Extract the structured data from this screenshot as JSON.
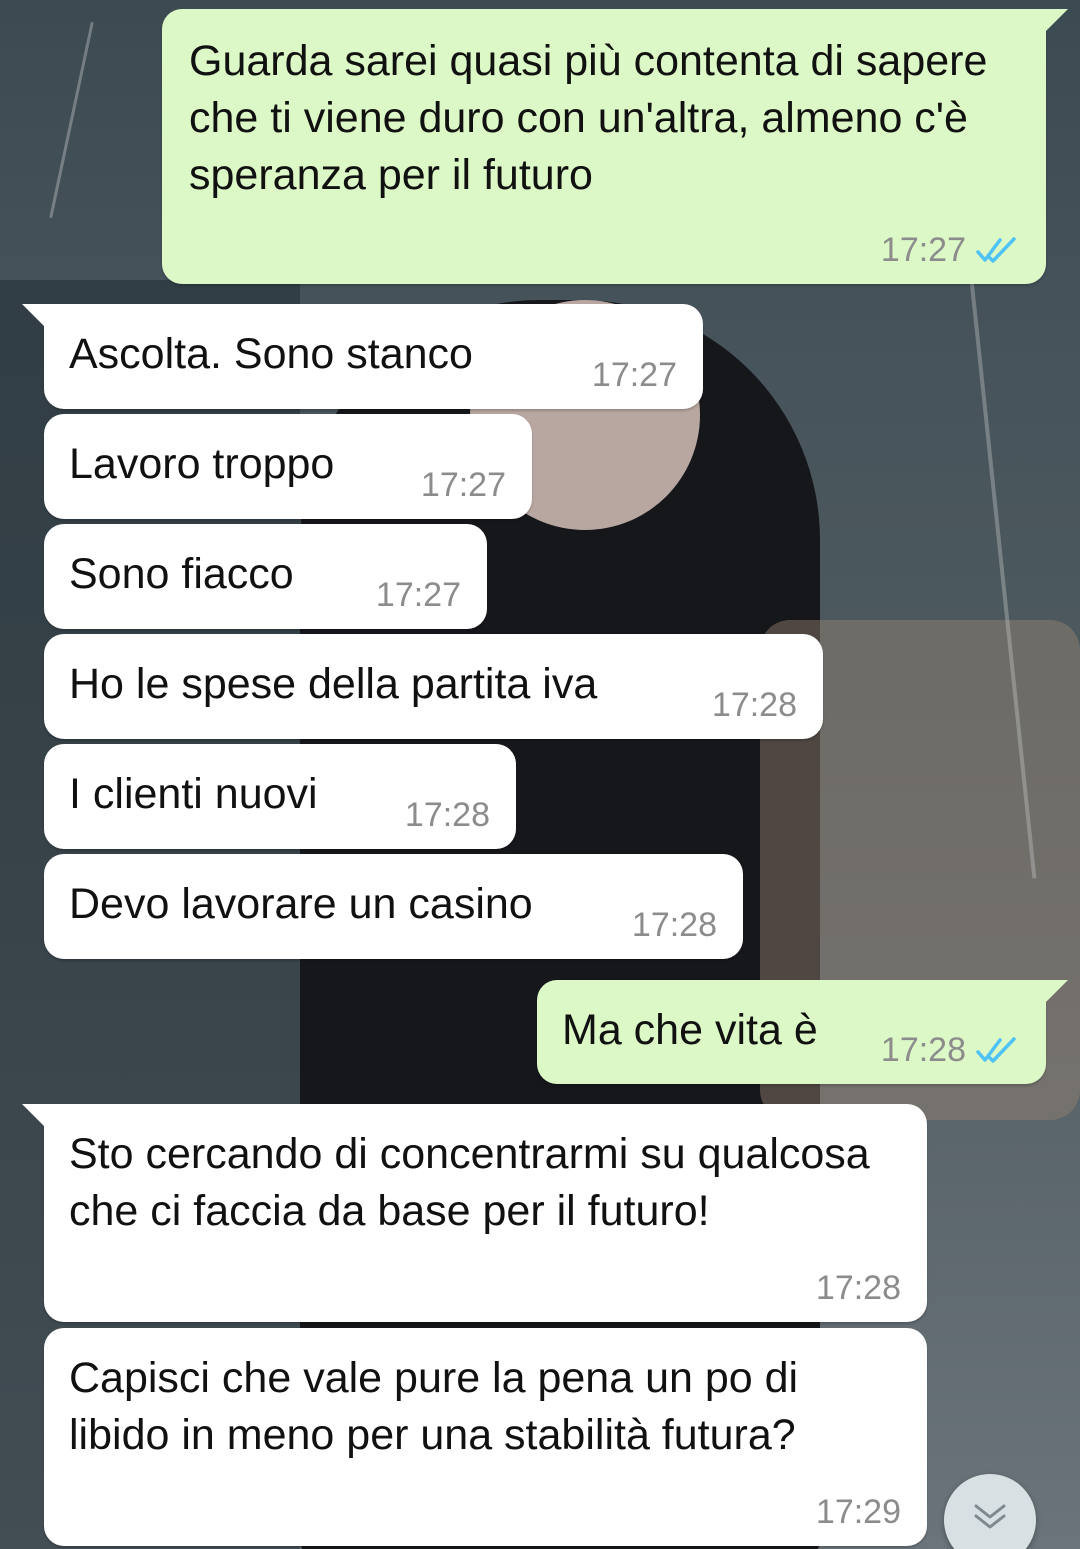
{
  "conversation": {
    "messages": [
      {
        "direction": "out",
        "text": "Guarda sarei quasi più contenta di sapere che ti viene duro con un'altra, almeno c'è speranza per il futuro",
        "time": "17:27",
        "status": "read"
      },
      {
        "direction": "in",
        "text": "Ascolta. Sono stanco",
        "time": "17:27"
      },
      {
        "direction": "in",
        "text": "Lavoro troppo",
        "time": "17:27"
      },
      {
        "direction": "in",
        "text": "Sono fiacco",
        "time": "17:27"
      },
      {
        "direction": "in",
        "text": "Ho le spese della partita iva",
        "time": "17:28"
      },
      {
        "direction": "in",
        "text": "I clienti nuovi",
        "time": "17:28"
      },
      {
        "direction": "in",
        "text": "Devo lavorare un casino",
        "time": "17:28"
      },
      {
        "direction": "out",
        "text": "Ma che vita è",
        "time": "17:28",
        "status": "read"
      },
      {
        "direction": "in",
        "text": "Sto cercando di concentrarmi su qualcosa che ci faccia da base per il futuro!",
        "time": "17:28"
      },
      {
        "direction": "in",
        "text": "Capisci che vale pure la pena un po di libido in meno per una stabilità futura?",
        "time": "17:29"
      }
    ]
  },
  "icons": {
    "read_receipt": "double-check-icon",
    "scroll_down": "chevron-down-icon"
  },
  "colors": {
    "outgoing_bubble": "#dcf8c6",
    "incoming_bubble": "#ffffff",
    "read_tick": "#4fc3f7",
    "timestamp": "#8c8c8c"
  }
}
